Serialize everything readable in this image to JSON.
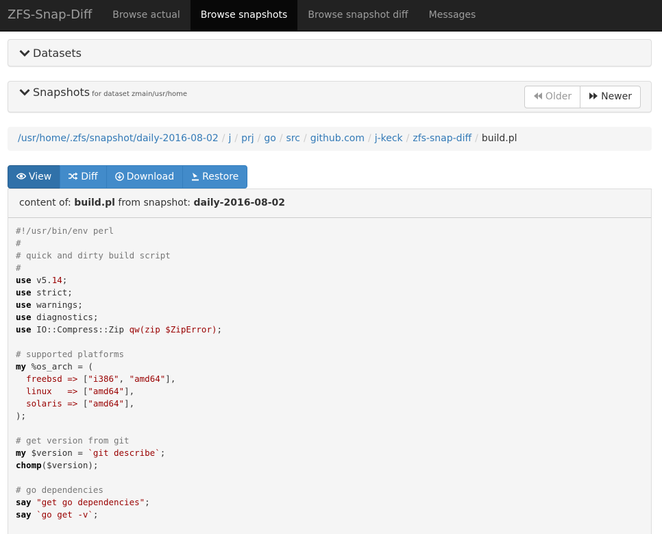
{
  "navbar": {
    "brand": "ZFS-Snap-Diff",
    "items": [
      {
        "label": "Browse actual",
        "active": false
      },
      {
        "label": "Browse snapshots",
        "active": true
      },
      {
        "label": "Browse snapshot diff",
        "active": false
      },
      {
        "label": "Messages",
        "active": false
      }
    ]
  },
  "datasets_panel": {
    "title": "Datasets"
  },
  "snapshots_panel": {
    "title": "Snapshots",
    "subtitle": "for dataset zmain/usr/home",
    "older_label": "Older",
    "newer_label": "Newer"
  },
  "breadcrumb": [
    "/usr/home/.zfs/snapshot/daily-2016-08-02",
    "j",
    "prj",
    "go",
    "src",
    "github.com",
    "j-keck",
    "zfs-snap-diff",
    "build.pl"
  ],
  "actions": {
    "view": "View",
    "diff": "Diff",
    "download": "Download",
    "restore": "Restore"
  },
  "content": {
    "prefix": "content of:",
    "file": "build.pl",
    "middle": "from snapshot:",
    "snapshot": "daily-2016-08-02"
  },
  "code_lines": [
    [
      [
        "comment",
        "#!/usr/bin/env perl"
      ]
    ],
    [
      [
        "comment",
        "#"
      ]
    ],
    [
      [
        "comment",
        "# quick and dirty build script"
      ]
    ],
    [
      [
        "comment",
        "#"
      ]
    ],
    [
      [
        "kw",
        "use"
      ],
      [
        "plain",
        " v5."
      ],
      [
        "num",
        "14"
      ],
      [
        "plain",
        ";"
      ]
    ],
    [
      [
        "kw",
        "use"
      ],
      [
        "plain",
        " strict;"
      ]
    ],
    [
      [
        "kw",
        "use"
      ],
      [
        "plain",
        " warnings;"
      ]
    ],
    [
      [
        "kw",
        "use"
      ],
      [
        "plain",
        " diagnostics;"
      ]
    ],
    [
      [
        "kw",
        "use"
      ],
      [
        "plain",
        " IO::Compress::Zip "
      ],
      [
        "str",
        "qw(zip $ZipError)"
      ],
      [
        "plain",
        ";"
      ]
    ],
    [],
    [
      [
        "comment",
        "# supported platforms"
      ]
    ],
    [
      [
        "kw",
        "my"
      ],
      [
        "plain",
        " %os_arch = ("
      ]
    ],
    [
      [
        "plain",
        "  "
      ],
      [
        "str",
        "freebsd =>"
      ],
      [
        "plain",
        " ["
      ],
      [
        "str",
        "\"i386\""
      ],
      [
        "plain",
        ", "
      ],
      [
        "str",
        "\"amd64\""
      ],
      [
        "plain",
        "],"
      ]
    ],
    [
      [
        "plain",
        "  "
      ],
      [
        "str",
        "linux   =>"
      ],
      [
        "plain",
        " ["
      ],
      [
        "str",
        "\"amd64\""
      ],
      [
        "plain",
        "],"
      ]
    ],
    [
      [
        "plain",
        "  "
      ],
      [
        "str",
        "solaris =>"
      ],
      [
        "plain",
        " ["
      ],
      [
        "str",
        "\"amd64\""
      ],
      [
        "plain",
        "],"
      ]
    ],
    [
      [
        "plain",
        ");"
      ]
    ],
    [],
    [
      [
        "comment",
        "# get version from git"
      ]
    ],
    [
      [
        "kw",
        "my"
      ],
      [
        "plain",
        " $version = "
      ],
      [
        "str",
        "`git describe`"
      ],
      [
        "plain",
        ";"
      ]
    ],
    [
      [
        "kw",
        "chomp"
      ],
      [
        "plain",
        "($version);"
      ]
    ],
    [],
    [
      [
        "comment",
        "# go dependencies"
      ]
    ],
    [
      [
        "kw",
        "say"
      ],
      [
        "plain",
        " "
      ],
      [
        "str",
        "\"get go dependencies\""
      ],
      [
        "plain",
        ";"
      ]
    ],
    [
      [
        "kw",
        "say"
      ],
      [
        "plain",
        " "
      ],
      [
        "str",
        "`go get -v`"
      ],
      [
        "plain",
        ";"
      ]
    ]
  ]
}
